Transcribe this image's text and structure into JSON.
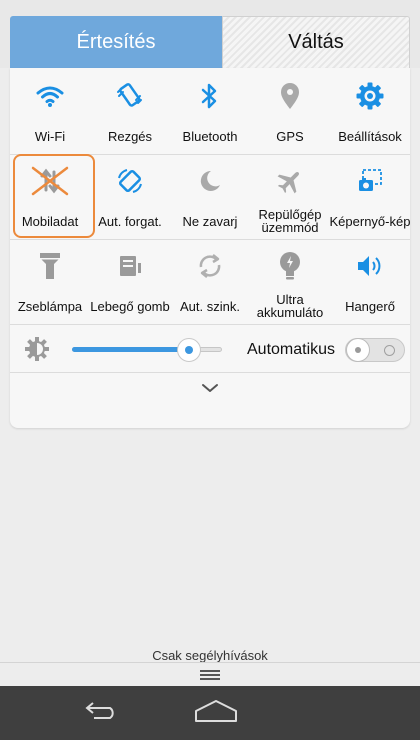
{
  "tabs": {
    "notifications": "Értesítés",
    "switches": "Váltás"
  },
  "colors": {
    "accent": "#1a8fe3",
    "highlight": "#ec8a3c",
    "tab_active": "#6fa8dc"
  },
  "toggles": {
    "row1": [
      {
        "label": "Wi-Fi",
        "icon": "wifi-icon",
        "state": "on"
      },
      {
        "label": "Rezgés",
        "icon": "vibrate-icon",
        "state": "on"
      },
      {
        "label": "Bluetooth",
        "icon": "bluetooth-icon",
        "state": "on"
      },
      {
        "label": "GPS",
        "icon": "location-icon",
        "state": "off"
      },
      {
        "label": "Beállítások",
        "icon": "gear-icon",
        "state": "on"
      }
    ],
    "row2": [
      {
        "label": "Mobiladat",
        "icon": "mobile-data-icon",
        "state": "off"
      },
      {
        "label": "Aut. forgat.",
        "icon": "auto-rotate-icon",
        "state": "on"
      },
      {
        "label": "Ne zavarj",
        "icon": "moon-icon",
        "state": "off"
      },
      {
        "label": "Repülőgép üzemmód",
        "icon": "airplane-icon",
        "state": "off"
      },
      {
        "label": "Képernyő-kép",
        "icon": "screenshot-icon",
        "state": "on"
      }
    ],
    "row3": [
      {
        "label": "Zseblámpa",
        "icon": "flashlight-icon",
        "state": "off"
      },
      {
        "label": "Lebegő gomb",
        "icon": "floating-button-icon",
        "state": "off"
      },
      {
        "label": "Aut. szink.",
        "icon": "sync-icon",
        "state": "off"
      },
      {
        "label": "Ultra akkumuláto",
        "icon": "battery-bulb-icon",
        "state": "off"
      },
      {
        "label": "Hangerő",
        "icon": "volume-icon",
        "state": "on"
      }
    ]
  },
  "brightness": {
    "level": 0.78,
    "auto_label": "Automatikus",
    "auto_on": false
  },
  "footer": {
    "emergency_text": "Csak segélyhívások"
  }
}
